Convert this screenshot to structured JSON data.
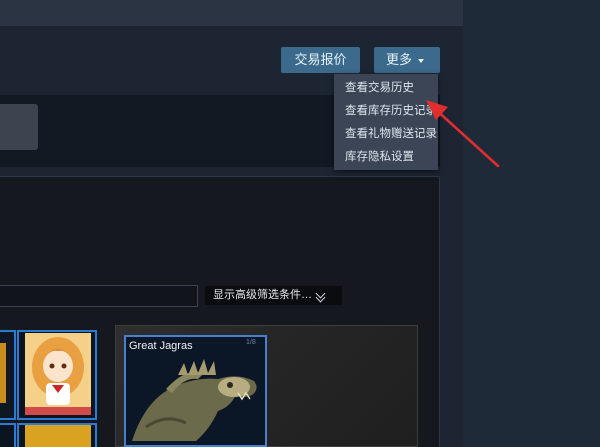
{
  "header": {
    "trade_offers_label": "交易报价",
    "more_label": "更多"
  },
  "more_menu": {
    "items": [
      {
        "label": "查看交易历史"
      },
      {
        "label": "查看库存历史记录"
      },
      {
        "label": "查看礼物赠送记录"
      },
      {
        "label": "库存隐私设置"
      }
    ]
  },
  "filters": {
    "search_value": "",
    "advanced_filter_label": "显示高级筛选条件…"
  },
  "selected_item": {
    "name": "Great Jagras",
    "rarity_badge": "1/8"
  },
  "icons": {
    "more_caret": "caret-down-icon",
    "advanced_filter_chevron": "double-chevron-down-icon",
    "annotation_arrow": "red-arrow"
  },
  "colors": {
    "button_bg": "#3c6a8c",
    "menu_bg": "#3b4555",
    "card_border": "#2d7bd1",
    "annotation_arrow": "#e02d2d"
  }
}
